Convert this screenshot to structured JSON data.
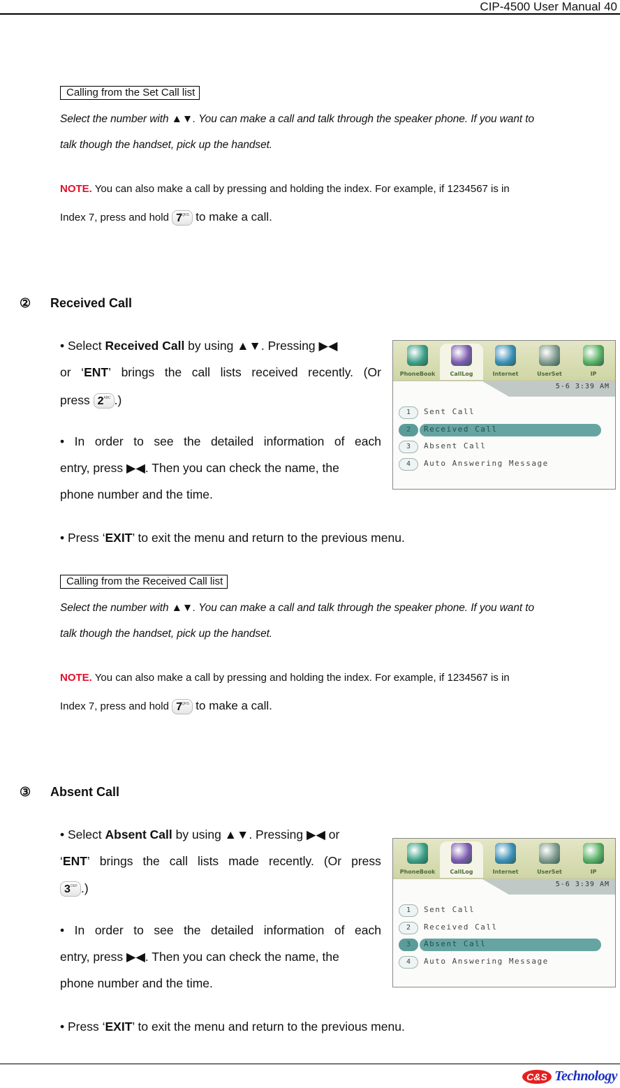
{
  "header": {
    "title": "CIP-4500 User Manual",
    "page_number": "40"
  },
  "set_call_list": {
    "box_label": "Calling from the Set Call list",
    "italic_line1": "Select the number with ▲▼. You can make a call and talk through the speaker phone. If you want to",
    "italic_line2": "talk though the handset, pick up the handset.",
    "note_label": "NOTE.",
    "note_line1": " You can also make a call by pressing and holding the index. For example, if 1234567 is in",
    "note_line2_pre": "Index 7, press and hold",
    "note_key": "7",
    "note_key_sub": "PQRS",
    "note_line2_post": "to make a call."
  },
  "received": {
    "number": "②",
    "title": "Received Call",
    "b1_pre": "• Select ",
    "b1_bold": "Received Call",
    "b1_post": " by using ▲▼. Pressing ▶◀",
    "b1_line2": [
      "or",
      "‘ENT’",
      "brings",
      "the",
      "call",
      "lists",
      "received",
      "recently.",
      "(Or"
    ],
    "b1_line3_pre": "press",
    "b1_key": "2",
    "b1_key_sub": "ABC",
    "b1_line3_post": ".)",
    "b2_line1": [
      "•",
      "In",
      "order",
      "to",
      "see",
      "the",
      "detailed",
      "information",
      "of",
      "each"
    ],
    "b2_line2": "entry, press ▶◀. Then you can check the name, the",
    "b2_line3": "phone number and the time.",
    "b3_pre": "• Press ‘",
    "b3_bold": "EXIT",
    "b3_post": "’ to exit the menu and return to the previous menu.",
    "box_label": "Calling from the Received Call list",
    "italic_line1": "Select the number with ▲▼. You can make a call and talk through the speaker phone. If you want to",
    "italic_line2": "talk though the handset, pick up the handset.",
    "note_label": "NOTE.",
    "note_line1": " You can also make a call by pressing and holding the index. For example, if 1234567 is in",
    "note_line2_pre": "Index 7, press and hold",
    "note_key": "7",
    "note_key_sub": "PQRS",
    "note_line2_post": "to make a call.",
    "screen": {
      "tabs": [
        "PhoneBook",
        "CallLog",
        "Internet",
        "UserSet",
        "IP"
      ],
      "active_tab": "CallLog",
      "datetime": "5-6  3:39 AM",
      "menu": [
        {
          "num": "1",
          "label": "Sent Call"
        },
        {
          "num": "2",
          "label": "Received Call"
        },
        {
          "num": "3",
          "label": "Absent Call"
        },
        {
          "num": "4",
          "label": "Auto Answering Message"
        }
      ],
      "selected_index": 2
    }
  },
  "absent": {
    "number": "③",
    "title": "Absent Call",
    "b1_pre": "• Select ",
    "b1_bold": "Absent Call",
    "b1_post": " by using ▲▼. Pressing ▶◀ or",
    "b1_line2": [
      "‘ENT’",
      "brings",
      "the",
      "call",
      "lists",
      "made",
      "recently.",
      "(Or",
      "press"
    ],
    "b1_key": "3",
    "b1_key_sub": "DEF",
    "b1_line3_post": ".)",
    "b2_line1": [
      "•",
      "In",
      "order",
      "to",
      "see",
      "the",
      "detailed",
      "information",
      "of",
      "each"
    ],
    "b2_line2": "entry, press ▶◀. Then you can check the name, the",
    "b2_line3": "phone number and the time.",
    "b3_pre": "• Press ‘",
    "b3_bold": "EXIT",
    "b3_post": "’ to exit the menu and return to the previous menu.",
    "screen": {
      "tabs": [
        "PhoneBook",
        "CallLog",
        "Internet",
        "UserSet",
        "IP"
      ],
      "active_tab": "CallLog",
      "datetime": "5-6  3:39 AM",
      "menu": [
        {
          "num": "1",
          "label": "Sent Call"
        },
        {
          "num": "2",
          "label": "Received Call"
        },
        {
          "num": "3",
          "label": "Absent Call"
        },
        {
          "num": "4",
          "label": "Auto Answering Message"
        }
      ],
      "selected_index": 3
    }
  },
  "footer": {
    "logo_badge": "C&S",
    "logo_word": "Technology"
  },
  "colors": {
    "note_red": "#e0102a",
    "selection_teal": "#66a4a2",
    "logo_red": "#e32020",
    "logo_blue": "#1a2fc0"
  }
}
